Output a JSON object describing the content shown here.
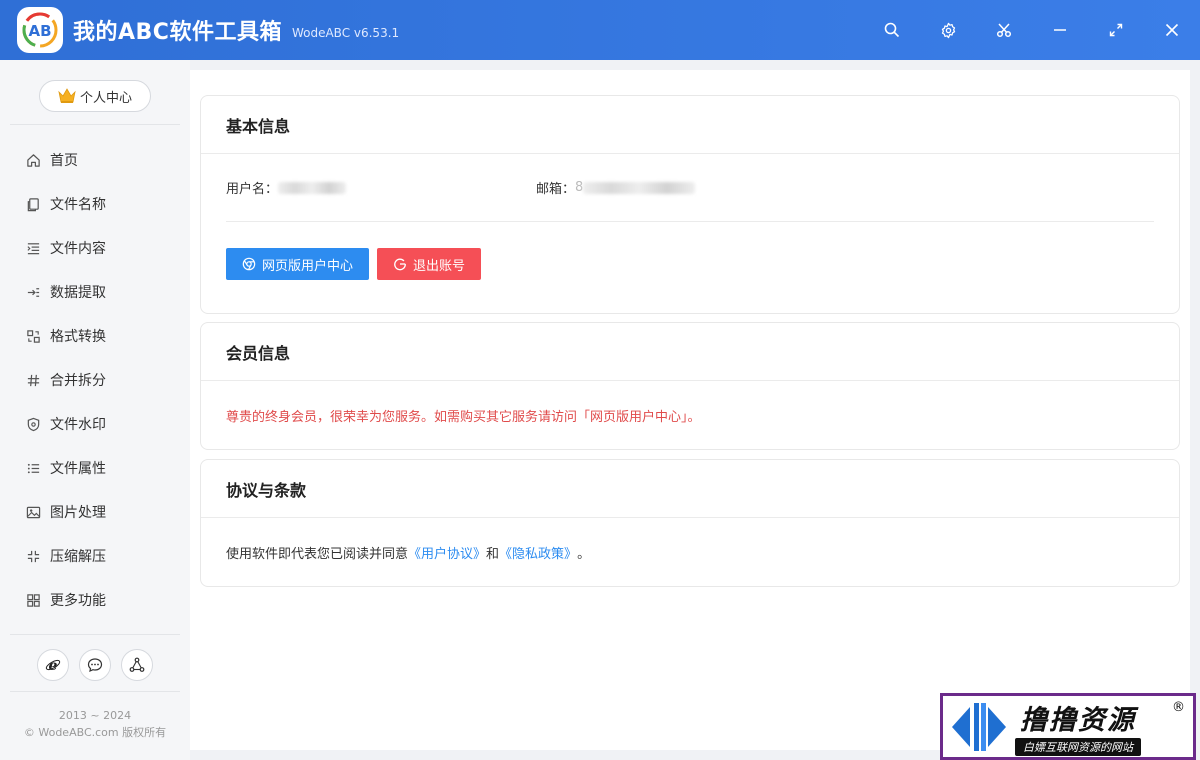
{
  "app": {
    "title": "我的ABC软件工具箱",
    "version": "WodeABC v6.53.1",
    "logo_text": "AB"
  },
  "window_controls": [
    "search-icon",
    "gear-icon",
    "scissors-icon",
    "minimize-icon",
    "maximize-icon",
    "close-icon"
  ],
  "sidebar": {
    "profile_label": "个人中心",
    "items": [
      {
        "label": "首页",
        "icon": "home-icon"
      },
      {
        "label": "文件名称",
        "icon": "file-copy-icon"
      },
      {
        "label": "文件内容",
        "icon": "list-indent-icon"
      },
      {
        "label": "数据提取",
        "icon": "extract-icon"
      },
      {
        "label": "格式转换",
        "icon": "convert-icon"
      },
      {
        "label": "合并拆分",
        "icon": "hash-icon"
      },
      {
        "label": "文件水印",
        "icon": "shield-icon"
      },
      {
        "label": "文件属性",
        "icon": "list-icon"
      },
      {
        "label": "图片处理",
        "icon": "image-icon"
      },
      {
        "label": "压缩解压",
        "icon": "compress-icon"
      },
      {
        "label": "更多功能",
        "icon": "grid-icon"
      }
    ],
    "bottom_icons": [
      "ie-browser-icon",
      "chat-icon",
      "share-icon"
    ],
    "copyright_years": "2013 ~ 2024",
    "copyright_owner": "© WodeABC.com 版权所有"
  },
  "basic_info": {
    "title": "基本信息",
    "username_label": "用户名：",
    "email_label": "邮箱：",
    "email_visible_char": "8",
    "web_center_button": "网页版用户中心",
    "logout_button": "退出账号"
  },
  "member_info": {
    "title": "会员信息",
    "message": "尊贵的终身会员，很荣幸为您服务。如需购买其它服务请访问「网页版用户中心」。"
  },
  "terms": {
    "title": "协议与条款",
    "prefix": "使用软件即代表您已阅读并同意",
    "user_agreement": "《用户协议》",
    "and": "和",
    "privacy_policy": "《隐私政策》",
    "suffix": "。"
  },
  "watermark": {
    "title": "撸撸资源",
    "subtitle": "白嫖互联网资源的网站",
    "reg": "®"
  },
  "colors": {
    "titlebar": "#3b7ee8",
    "primary": "#2d8cf0",
    "danger": "#f54f56",
    "member_text": "#e04b4b"
  }
}
